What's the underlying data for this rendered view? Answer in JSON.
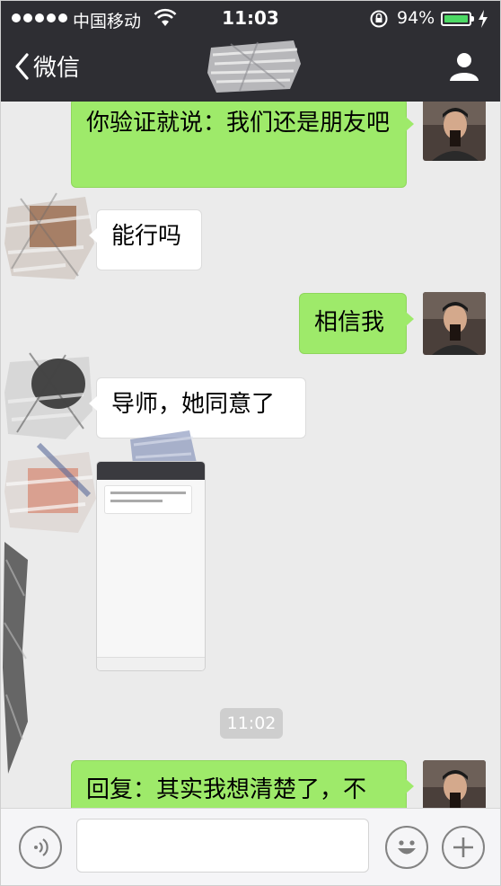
{
  "status_bar": {
    "carrier": "中国移动",
    "time": "11:03",
    "battery_percent": "94%",
    "battery_level": 0.94
  },
  "nav": {
    "back_label": "微信"
  },
  "messages": [
    {
      "side": "sent",
      "text": "你验证就说：我们还是朋友吧"
    },
    {
      "side": "received",
      "text": "能行吗"
    },
    {
      "side": "sent",
      "text": "相信我"
    },
    {
      "side": "received",
      "text": "导师，她同意了"
    },
    {
      "side": "received",
      "type": "image",
      "text": ""
    },
    {
      "type": "timestamp",
      "text": "11:02"
    },
    {
      "side": "sent",
      "text": "回复：其实我想清楚了，不"
    }
  ],
  "input_bar": {
    "voice_icon": "voice-icon",
    "emoji_icon": "emoji-icon",
    "plus_icon": "plus-icon"
  },
  "colors": {
    "nav_bg": "#2e2e33",
    "sent_bubble": "#9eea6a",
    "received_bubble": "#ffffff",
    "chat_bg": "#ebebeb",
    "battery": "#4cd964"
  }
}
